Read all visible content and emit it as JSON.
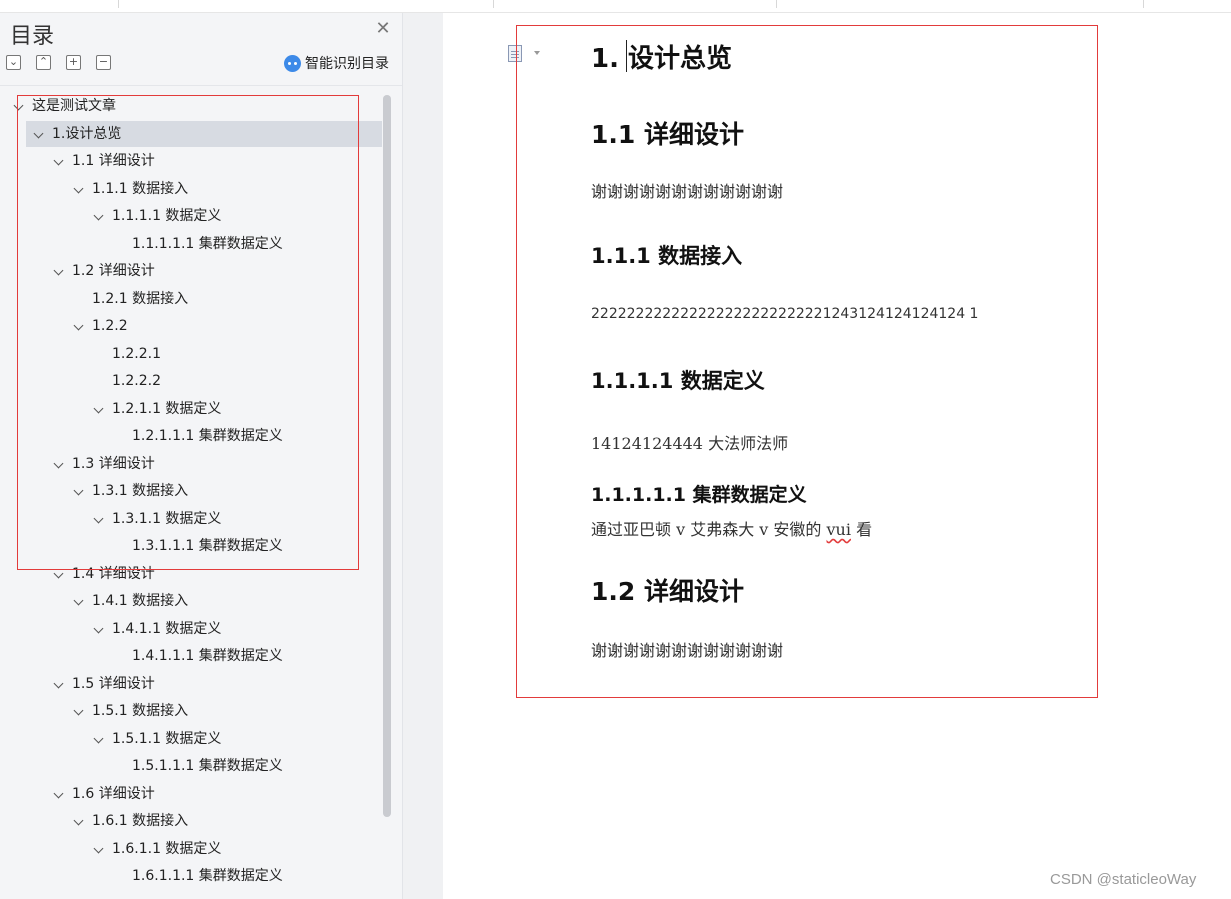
{
  "sidebar": {
    "title": "目录",
    "smart_recognize_label": "智能识别目录",
    "tool_icons": [
      "collapse-all-icon",
      "expand-all-icon",
      "add-icon",
      "remove-icon"
    ],
    "tree": [
      {
        "label": "这是测试文章",
        "level": 0,
        "expandable": true,
        "selected": false
      },
      {
        "label": "1.设计总览",
        "level": 1,
        "expandable": true,
        "selected": true
      },
      {
        "label": "1.1 详细设计",
        "level": 2,
        "expandable": true,
        "selected": false
      },
      {
        "label": "1.1.1 数据接入",
        "level": 3,
        "expandable": true,
        "selected": false
      },
      {
        "label": "1.1.1.1 数据定义",
        "level": 4,
        "expandable": true,
        "selected": false
      },
      {
        "label": "1.1.1.1.1  集群数据定义",
        "level": 5,
        "expandable": false,
        "selected": false
      },
      {
        "label": "1.2 详细设计",
        "level": 2,
        "expandable": true,
        "selected": false
      },
      {
        "label": "1.2.1 数据接入",
        "level": 3,
        "expandable": false,
        "selected": false
      },
      {
        "label": "1.2.2",
        "level": 3,
        "expandable": true,
        "selected": false
      },
      {
        "label": "1.2.2.1",
        "level": 4,
        "expandable": false,
        "selected": false
      },
      {
        "label": "1.2.2.2",
        "level": 4,
        "expandable": false,
        "selected": false
      },
      {
        "label": "1.2.1.1 数据定义",
        "level": 4,
        "expandable": true,
        "selected": false
      },
      {
        "label": "1.2.1.1.1  集群数据定义",
        "level": 5,
        "expandable": false,
        "selected": false
      },
      {
        "label": "1.3 详细设计",
        "level": 2,
        "expandable": true,
        "selected": false
      },
      {
        "label": "1.3.1 数据接入",
        "level": 3,
        "expandable": true,
        "selected": false
      },
      {
        "label": "1.3.1.1 数据定义",
        "level": 4,
        "expandable": true,
        "selected": false
      },
      {
        "label": "1.3.1.1.1  集群数据定义",
        "level": 5,
        "expandable": false,
        "selected": false
      },
      {
        "label": "1.4 详细设计",
        "level": 2,
        "expandable": true,
        "selected": false
      },
      {
        "label": "1.4.1 数据接入",
        "level": 3,
        "expandable": true,
        "selected": false
      },
      {
        "label": "1.4.1.1 数据定义",
        "level": 4,
        "expandable": true,
        "selected": false
      },
      {
        "label": "1.4.1.1.1  集群数据定义",
        "level": 5,
        "expandable": false,
        "selected": false
      },
      {
        "label": "1.5 详细设计",
        "level": 2,
        "expandable": true,
        "selected": false
      },
      {
        "label": "1.5.1 数据接入",
        "level": 3,
        "expandable": true,
        "selected": false
      },
      {
        "label": "1.5.1.1 数据定义",
        "level": 4,
        "expandable": true,
        "selected": false
      },
      {
        "label": "1.5.1.1.1  集群数据定义",
        "level": 5,
        "expandable": false,
        "selected": false
      },
      {
        "label": "1.6 详细设计",
        "level": 2,
        "expandable": true,
        "selected": false
      },
      {
        "label": "1.6.1 数据接入",
        "level": 3,
        "expandable": true,
        "selected": false
      },
      {
        "label": "1.6.1.1 数据定义",
        "level": 4,
        "expandable": true,
        "selected": false
      },
      {
        "label": "1.6.1.1.1  集群数据定义",
        "level": 5,
        "expandable": false,
        "selected": false
      }
    ]
  },
  "document": {
    "h1": "1. 设计总览",
    "h2_1": "1.1 详细设计",
    "p1": "谢谢谢谢谢谢谢谢谢谢谢谢",
    "h3_1": "1.1.1 数据接入",
    "p2": "222222222222222222222222221243124124124124 1",
    "h4_1": "1.1.1.1 数据定义",
    "p3": "14124124444 大法师法师",
    "h5_1": "1.1.1.1.1  集群数据定义",
    "p4_a": "通过亚巴顿 v 艾弗森大 v 安徽的 ",
    "p4_b": "vui",
    "p4_c": " 看",
    "h2_2": "1.2 详细设计",
    "p5": "谢谢谢谢谢谢谢谢谢谢谢谢"
  },
  "watermark": "CSDN @staticleoWay",
  "colors": {
    "annotation_red": "#e23b3b",
    "selected_row": "#d7dbe2",
    "smart_icon": "#3d8ae8"
  }
}
